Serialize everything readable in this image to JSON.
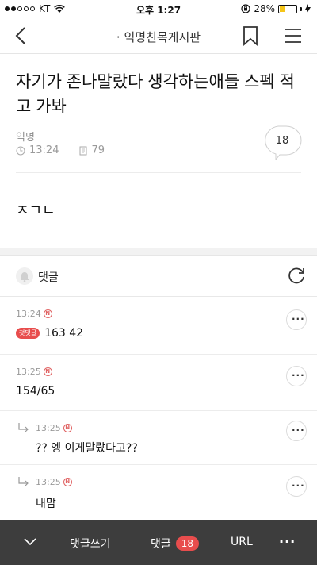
{
  "status_bar": {
    "carrier": "KT",
    "time": "오후 1:27",
    "battery": "28%",
    "battery_level": 0.28,
    "battery_color": "#f5c518"
  },
  "nav": {
    "title": "· 익명친목게시판",
    "icons": [
      "back-chevron-icon",
      "bookmark-icon",
      "hamburger-menu-icon"
    ]
  },
  "post": {
    "title": "자기가 존나말랐다 생각하는애들 스펙 적고 가봐",
    "author": "익명",
    "time": "13:24",
    "views": "79",
    "comment_count": "18",
    "body": "ㅈㄱㄴ"
  },
  "comments_section": {
    "label": "댓글"
  },
  "comments": [
    {
      "time": "13:24",
      "new_badge": "N",
      "first_badge": "첫댓글",
      "text": "163 42",
      "reply": false
    },
    {
      "time": "13:25",
      "new_badge": "N",
      "text": "154/65",
      "reply": false
    },
    {
      "time": "13:25",
      "new_badge": "N",
      "text": "?? 엥 이게말랐다고??",
      "reply": true
    },
    {
      "time": "13:25",
      "new_badge": "N",
      "text": "내맘",
      "reply": true
    }
  ],
  "bottom_bar": {
    "write": "댓글쓰기",
    "comments": "댓글",
    "comments_count": "18",
    "url": "URL",
    "more": "···"
  },
  "colors": {
    "accent_red": "#e84d4d",
    "bottom_bar_bg": "#3d3d3d"
  }
}
